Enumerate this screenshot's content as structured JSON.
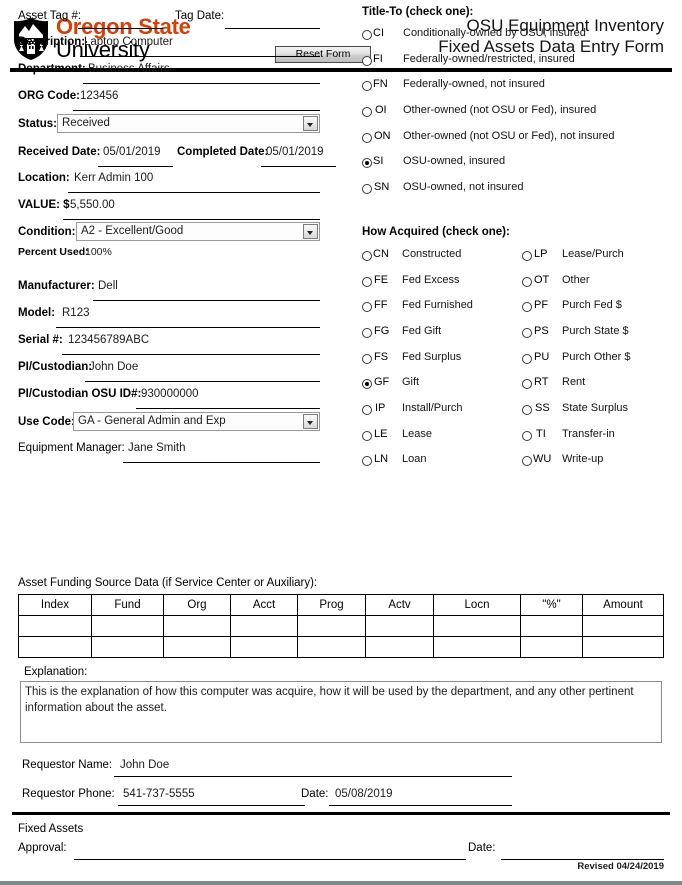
{
  "header": {
    "logo_line1": "Oregon State",
    "logo_line2": "University",
    "logo_color": "#d73f09",
    "shield_icon": "osu-shield-icon",
    "reset_button": "Reset Form",
    "title_line1": "OSU Equipment Inventory",
    "title_line2": "Fixed Assets Data Entry Form"
  },
  "left_fields": {
    "asset_tag_label": "Asset Tag #:",
    "asset_tag_value": "",
    "tag_date_label": "Tag Date:",
    "tag_date_value": "",
    "description_label": "Description:",
    "description_value": "Laptop Computer",
    "department_label": "Department:",
    "department_value": "Business Affairs",
    "org_code_label": "ORG Code:",
    "org_code_value": "123456",
    "status_label": "Status:",
    "status_value": "Received",
    "received_date_label": "Received Date:",
    "received_date_value": "05/01/2019",
    "completed_date_label": "Completed Date:",
    "completed_date_value": "05/01/2019",
    "location_label": "Location:",
    "location_value": "Kerr Admin 100",
    "value_label": "VALUE: $",
    "value_value": "5,550.00",
    "condition_label": "Condition:",
    "condition_value": "A2 - Excellent/Good",
    "percent_used_label": "Percent Used:",
    "percent_used_value": "100%",
    "manufacturer_label": "Manufacturer:",
    "manufacturer_value": "Dell",
    "model_label": "Model:",
    "model_value": "R123",
    "serial_label": "Serial #:",
    "serial_value": "123456789ABC",
    "pi_custodian_label": "PI/Custodian:",
    "pi_custodian_value": "John Doe",
    "pi_osu_id_label": "PI/Custodian OSU ID#:",
    "pi_osu_id_value": "930000000",
    "use_code_label": "Use Code:",
    "use_code_value": "GA - General Admin and Exp",
    "equipment_manager_label": "Equipment Manager:",
    "equipment_manager_value": "Jane Smith"
  },
  "title_to": {
    "heading": "Title-To (check one):",
    "options": [
      {
        "code": "CI",
        "text": "Conditionally-owned by OSU, insured",
        "selected": false
      },
      {
        "code": "FI",
        "text": "Federally-owned/restricted, insured",
        "selected": false
      },
      {
        "code": "FN",
        "text": "Federally-owned, not insured",
        "selected": false
      },
      {
        "code": "OI",
        "text": "Other-owned (not OSU or Fed), insured",
        "selected": false
      },
      {
        "code": "ON",
        "text": "Other-owned (not OSU or Fed), not insured",
        "selected": false
      },
      {
        "code": "SI",
        "text": "OSU-owned, insured",
        "selected": true
      },
      {
        "code": "SN",
        "text": "OSU-owned, not insured",
        "selected": false
      }
    ]
  },
  "how_acquired": {
    "heading": "How Acquired (check one):",
    "left_options": [
      {
        "code": "CN",
        "text": "Constructed",
        "selected": false
      },
      {
        "code": "FE",
        "text": "Fed Excess",
        "selected": false
      },
      {
        "code": "FF",
        "text": "Fed Furnished",
        "selected": false
      },
      {
        "code": "FG",
        "text": "Fed Gift",
        "selected": false
      },
      {
        "code": "FS",
        "text": "Fed Surplus",
        "selected": false
      },
      {
        "code": "GF",
        "text": "Gift",
        "selected": true
      },
      {
        "code": "IP",
        "text": "Install/Purch",
        "selected": false
      },
      {
        "code": "LE",
        "text": "Lease",
        "selected": false
      },
      {
        "code": "LN",
        "text": "Loan",
        "selected": false
      }
    ],
    "right_options": [
      {
        "code": "LP",
        "text": "Lease/Purch",
        "selected": false
      },
      {
        "code": "OT",
        "text": "Other",
        "selected": false
      },
      {
        "code": "PF",
        "text": "Purch Fed $",
        "selected": false
      },
      {
        "code": "PS",
        "text": "Purch State $",
        "selected": false
      },
      {
        "code": "PU",
        "text": "Purch Other $",
        "selected": false
      },
      {
        "code": "RT",
        "text": "Rent",
        "selected": false
      },
      {
        "code": "SS",
        "text": "State Surplus",
        "selected": false
      },
      {
        "code": "TI",
        "text": "Transfer-in",
        "selected": false
      },
      {
        "code": "WU",
        "text": "Write-up",
        "selected": false
      }
    ]
  },
  "funding": {
    "label": "Asset Funding Source Data (if Service Center or Auxiliary):",
    "columns": [
      "Index",
      "Fund",
      "Org",
      "Acct",
      "Prog",
      "Actv",
      "Locn",
      "\"%\"",
      "Amount"
    ],
    "rows": [
      [
        "",
        "",
        "",
        "",
        "",
        "",
        "",
        "",
        ""
      ],
      [
        "",
        "",
        "",
        "",
        "",
        "",
        "",
        "",
        ""
      ]
    ]
  },
  "explanation": {
    "label": "Explanation:",
    "value": "This is the explanation of how this computer was acquire, how it will be used by the department, and any other pertinent information about the asset."
  },
  "requestor": {
    "name_label": "Requestor Name:",
    "name_value": "John Doe",
    "phone_label": "Requestor Phone:",
    "phone_value": "541-737-5555",
    "date_label": "Date:",
    "date_value": "05/08/2019"
  },
  "footer": {
    "section_label": "Fixed Assets",
    "approval_label": "Approval:",
    "approval_value": "",
    "date_label": "Date:",
    "date_value": "",
    "revised": "Revised 04/24/2019"
  }
}
